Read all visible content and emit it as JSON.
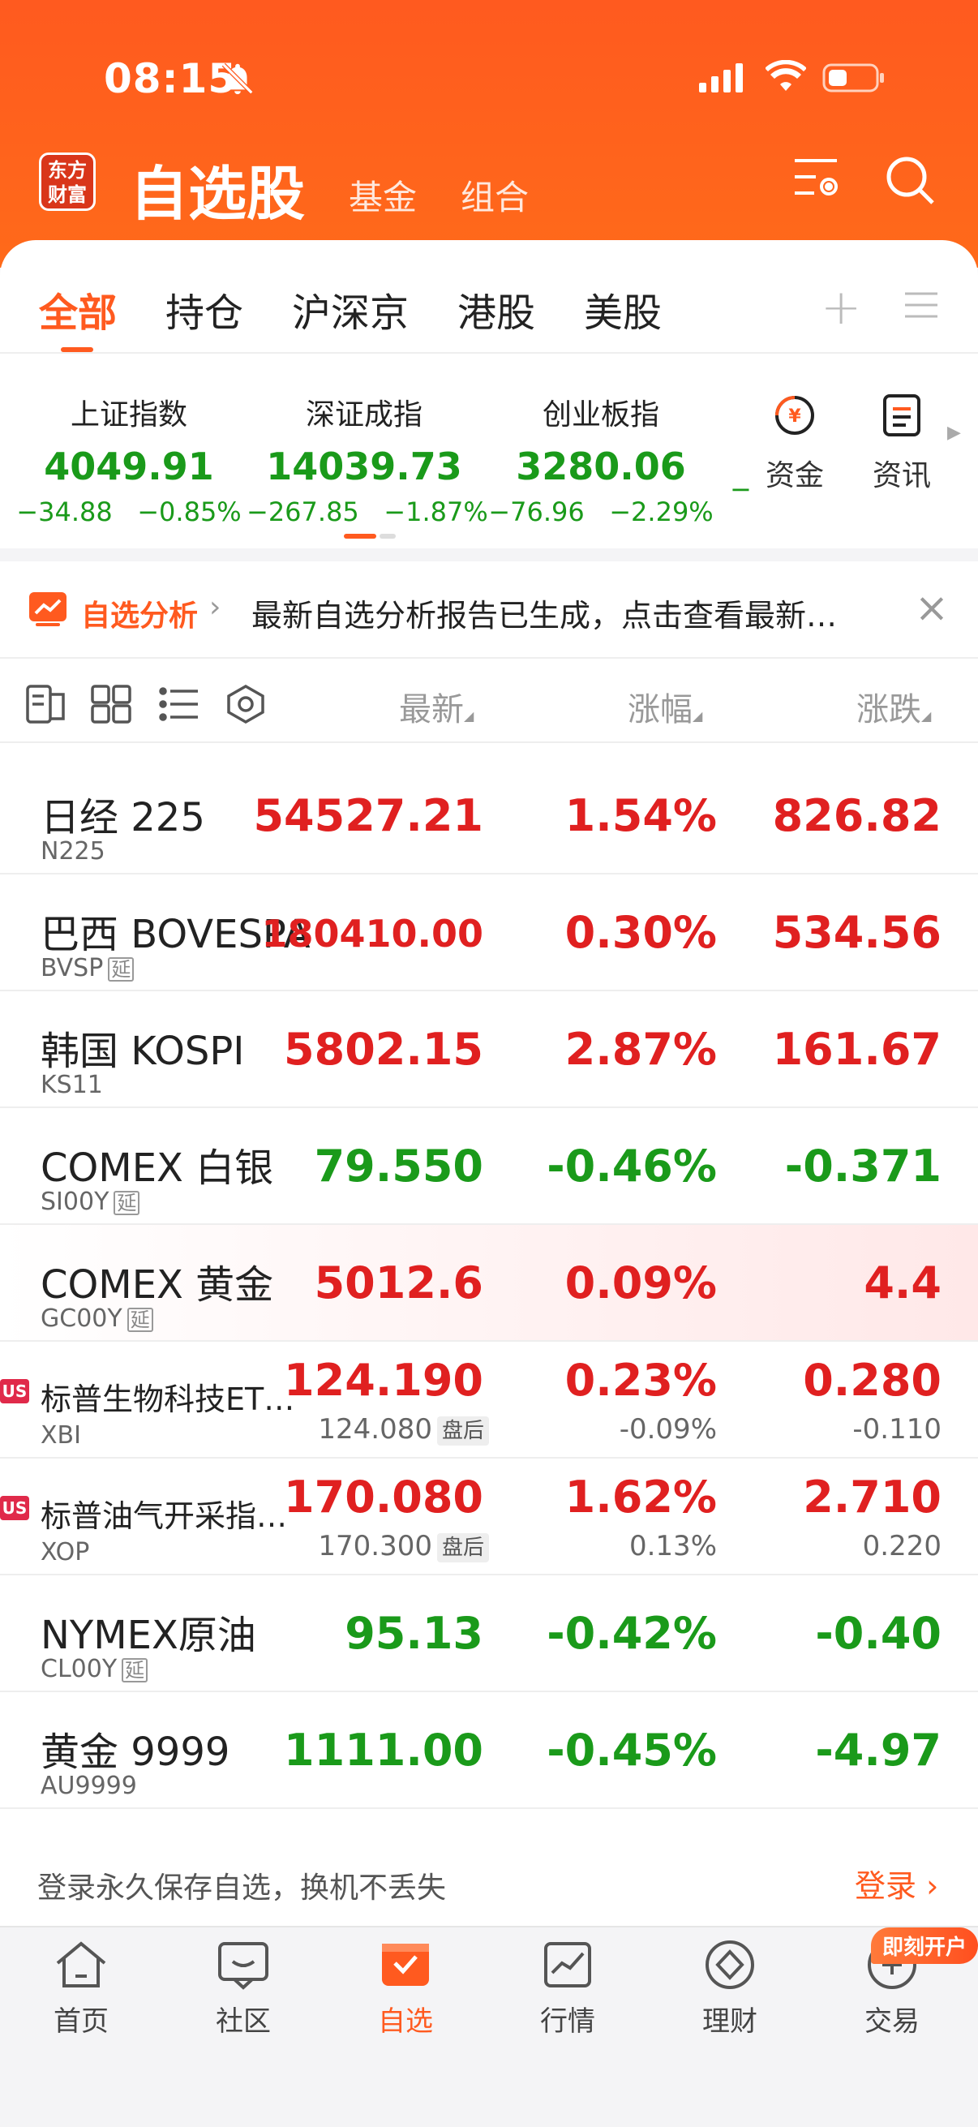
{
  "status_bar": {
    "time": "08:15"
  },
  "header": {
    "logo_text_1": "东方",
    "logo_text_2": "财富",
    "title": "自选股",
    "tabs": [
      "基金",
      "组合"
    ]
  },
  "category_tabs": [
    "全部",
    "持仓",
    "沪深京",
    "港股",
    "美股"
  ],
  "indices": [
    {
      "name": "上证指数",
      "value": "4049.91",
      "change": "−34.88",
      "percent": "−0.85%"
    },
    {
      "name": "深证成指",
      "value": "14039.73",
      "change": "−267.85",
      "percent": "−1.87%"
    },
    {
      "name": "创业板指",
      "value": "3280.06",
      "change": "−76.96",
      "percent": "−2.29%"
    }
  ],
  "index_overflow": "−",
  "quick_links": [
    "资金",
    "资讯"
  ],
  "banner": {
    "tag": "自选分析",
    "text": "最新自选分析报告已生成，点击查看最新…"
  },
  "columns": {
    "price": "最新",
    "pct": "涨幅",
    "chg": "涨跌"
  },
  "rows": [
    {
      "name": "日经 225",
      "code": "N225",
      "price": "54527.21",
      "pct": "1.54%",
      "chg": "826.82",
      "color": "#e02020"
    },
    {
      "name": "巴西 BOVESPA",
      "code": "BVSP",
      "delayed": "延",
      "price": "180410.00",
      "pct": "0.30%",
      "chg": "534.56",
      "color": "#e02020"
    },
    {
      "name": "韩国 KOSPI",
      "code": "KS11",
      "price": "5802.15",
      "pct": "2.87%",
      "chg": "161.67",
      "color": "#e02020"
    },
    {
      "name": "COMEX 白银",
      "code": "SI00Y",
      "delayed": "延",
      "price": "79.550",
      "pct": "-0.46%",
      "chg": "-0.371",
      "color": "#1a9a1a"
    },
    {
      "name": "COMEX 黄金",
      "code": "GC00Y",
      "delayed": "延",
      "price": "5012.6",
      "pct": "0.09%",
      "chg": "4.4",
      "color": "#e02020"
    },
    {
      "name": "标普生物科技ET…",
      "code": "XBI",
      "badge": "US",
      "price": "124.190",
      "pct": "0.23%",
      "chg": "0.280",
      "color": "#e02020",
      "after_price": "124.080",
      "after_tag": "盘后",
      "after_pct": "-0.09%",
      "after_chg": "-0.110"
    },
    {
      "name": "标普油气开采指…",
      "code": "XOP",
      "badge": "US",
      "price": "170.080",
      "pct": "1.62%",
      "chg": "2.710",
      "color": "#e02020",
      "after_price": "170.300",
      "after_tag": "盘后",
      "after_pct": "0.13%",
      "after_chg": "0.220"
    },
    {
      "name": "NYMEX原油",
      "code": "CL00Y",
      "delayed": "延",
      "price": "95.13",
      "pct": "-0.42%",
      "chg": "-0.40",
      "color": "#1a9a1a"
    },
    {
      "name": "黄金 9999",
      "code": "AU9999",
      "price": "1111.00",
      "pct": "-0.45%",
      "chg": "-4.97",
      "color": "#1a9a1a"
    }
  ],
  "login": {
    "text": "登录永久保存自选，换机不丢失",
    "button": "登录"
  },
  "bottom_nav": [
    "首页",
    "社区",
    "自选",
    "行情",
    "理财",
    "交易"
  ],
  "open_account_badge": "即刻开户",
  "colors": {
    "accent": "#ff5a1f",
    "up": "#e02020",
    "down": "#1a9a1a"
  }
}
